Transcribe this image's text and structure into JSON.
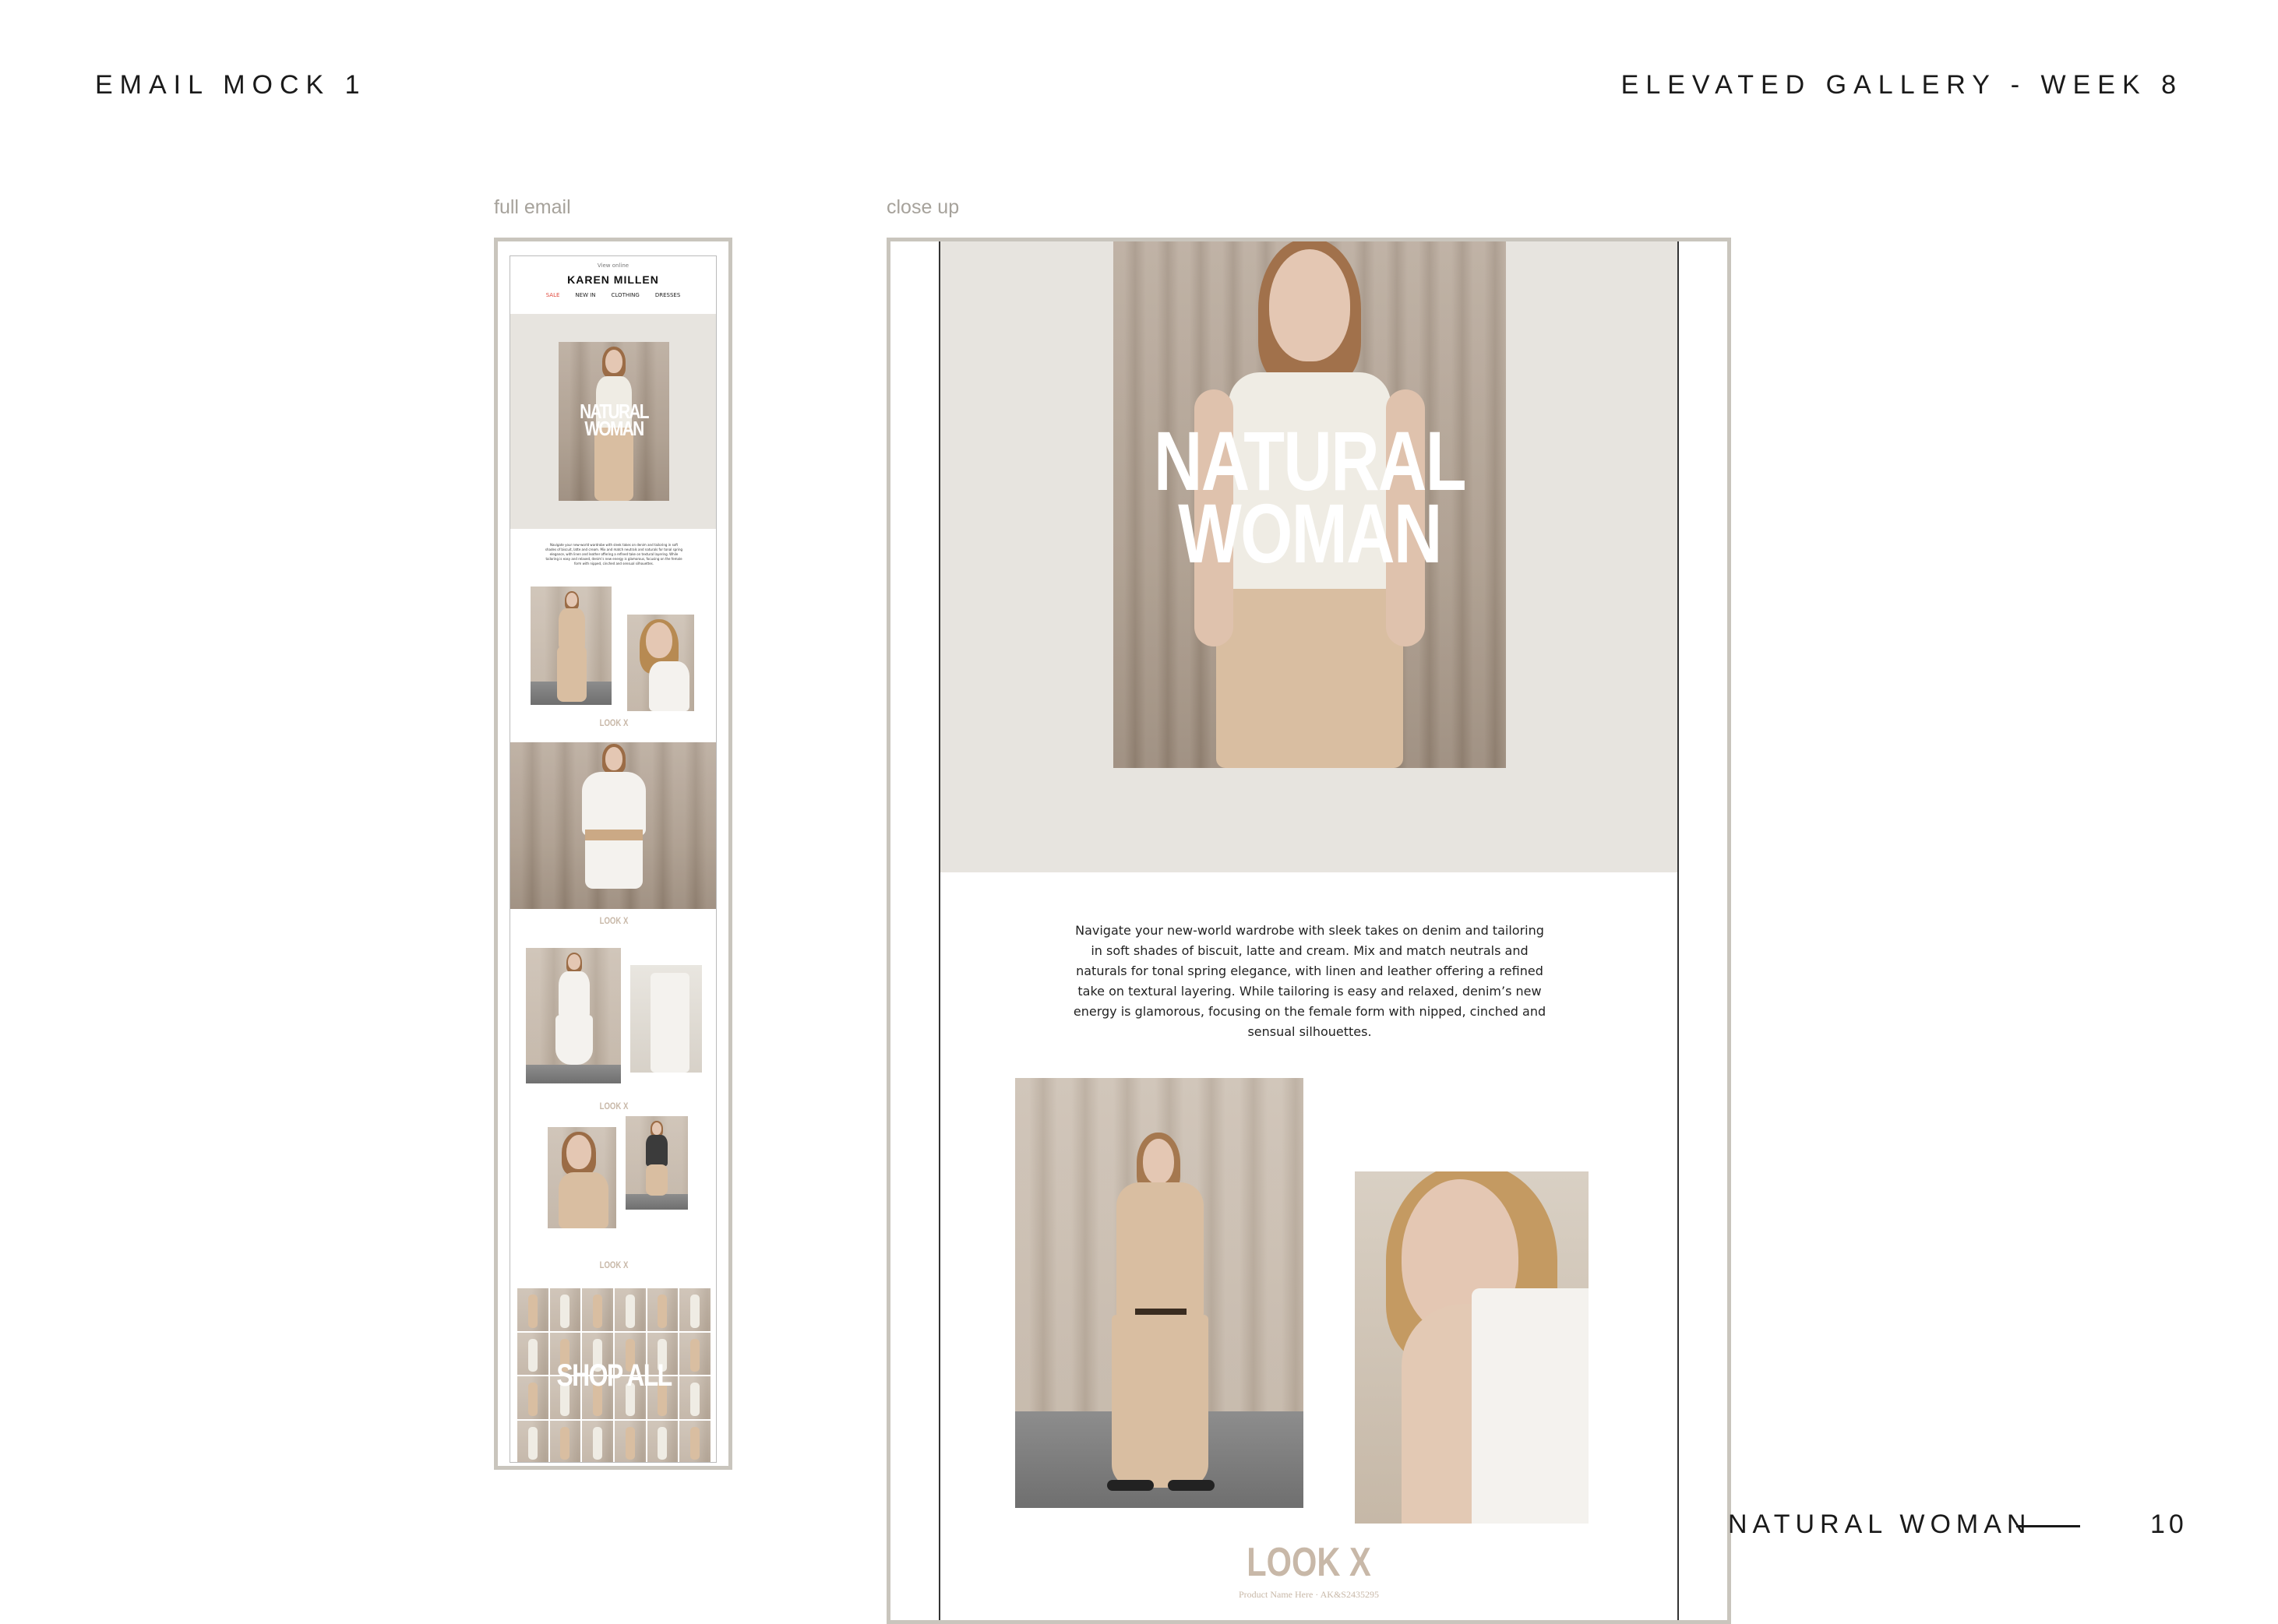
{
  "header": {
    "left": "EMAIL MOCK 1",
    "right": "ELEVATED GALLERY - WEEK 8"
  },
  "captions": {
    "full": "full email",
    "close": "close up"
  },
  "email": {
    "preheader": "View online",
    "brand": "KAREN MILLEN",
    "nav": [
      "SALE",
      "NEW IN",
      "CLOTHING",
      "DRESSES"
    ],
    "hero_title_line1": "NATURAL",
    "hero_title_line2": "WOMAN",
    "body_text": "Navigate your new-world wardrobe with sleek takes on denim and tailoring in soft shades of biscuit, latte and cream. Mix and match neutrals and naturals for tonal spring elegance, with linen and leather offering a refined take on textural layering. While tailoring is easy and relaxed, denim’s new energy is glamorous, focusing on the female form with nipped, cinched and sensual silhouettes.",
    "look_label": "LOOK X",
    "product_line": "Product Name Here · AK&S2435295",
    "shop_all": "SHOP ALL"
  },
  "footer": {
    "title": "NATURAL WOMAN",
    "page": "10"
  },
  "colors": {
    "frame": "#c9c5bd",
    "caption": "#a6a29b",
    "hero_bg": "#e7e4df",
    "sale": "#e0483c",
    "look": "#c8b8a8"
  }
}
